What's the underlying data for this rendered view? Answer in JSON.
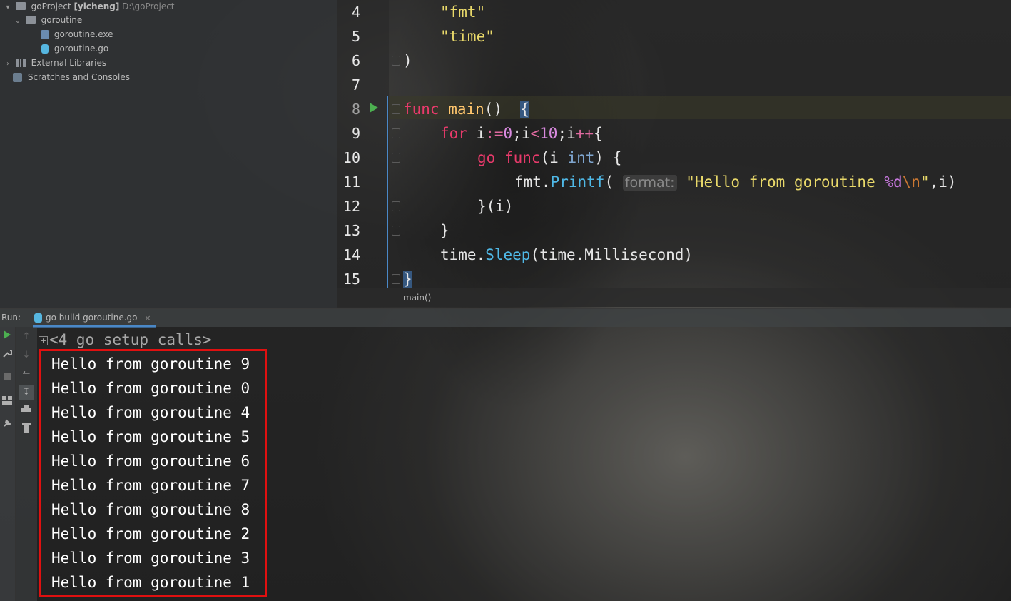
{
  "project": {
    "root_name": "goProject",
    "root_user": "[yicheng]",
    "root_path": "D:\\goProject",
    "folder": "goroutine",
    "files": [
      "goroutine.exe",
      "goroutine.go"
    ],
    "external_libraries": "External Libraries",
    "scratches": "Scratches and Consoles"
  },
  "editor": {
    "line_numbers": [
      "4",
      "5",
      "6",
      "7",
      "8",
      "9",
      "10",
      "11",
      "12",
      "13",
      "14",
      "15"
    ],
    "lines": {
      "l4": "\"fmt\"",
      "l5": "\"time\"",
      "l6": ")",
      "l8_kw": "func",
      "l8_name": "main",
      "l8_rest": "()",
      "l8_brace": "{",
      "l9_kw": "for",
      "l9_a": "i",
      "l9_op1": ":=",
      "l9_num1": "0",
      "l9_b": ";i",
      "l9_op2": "<",
      "l9_num2": "10",
      "l9_c": ";i",
      "l9_op3": "++",
      "l9_d": "{",
      "l10_kw1": "go",
      "l10_kw2": "func",
      "l10_a": "(i",
      "l10_type": "int",
      "l10_b": ") {",
      "l11_pkg": "fmt.",
      "l11_fn": "Printf",
      "l11_paren": "(",
      "l11_hint": "format:",
      "l11_str1": "\"Hello from goroutine ",
      "l11_fmt": "%d",
      "l11_esc": "\\n",
      "l11_str2": "\"",
      "l11_tail": ",i)",
      "l12": "}(i)",
      "l13": "}",
      "l14_a": "time.",
      "l14_fn": "Sleep",
      "l14_b": "(time.Millisecond)",
      "l15": "}"
    },
    "breadcrumb": "main()"
  },
  "run": {
    "label": "Run:",
    "tab_label": "go build goroutine.go",
    "tab_close": "×",
    "setup_calls": "<4 go setup calls>",
    "output": [
      "Hello from goroutine 9",
      "Hello from goroutine 0",
      "Hello from goroutine 4",
      "Hello from goroutine 5",
      "Hello from goroutine 6",
      "Hello from goroutine 7",
      "Hello from goroutine 8",
      "Hello from goroutine 2",
      "Hello from goroutine 3",
      "Hello from goroutine 1"
    ]
  },
  "icons": [
    "folder-icon",
    "file-icon",
    "go-file-icon",
    "library-icon",
    "scratch-icon",
    "run-icon",
    "wrench-icon",
    "stop-icon",
    "layout-icon",
    "pin-icon",
    "up-arrow-icon",
    "down-arrow-icon",
    "soft-wrap-icon",
    "scroll-to-end-icon",
    "print-icon",
    "trash-icon"
  ],
  "colors": {
    "highlight_box": "#e01010",
    "keyword": "#e83a6b",
    "string": "#e9d96a",
    "function": "#4fb8e6"
  }
}
